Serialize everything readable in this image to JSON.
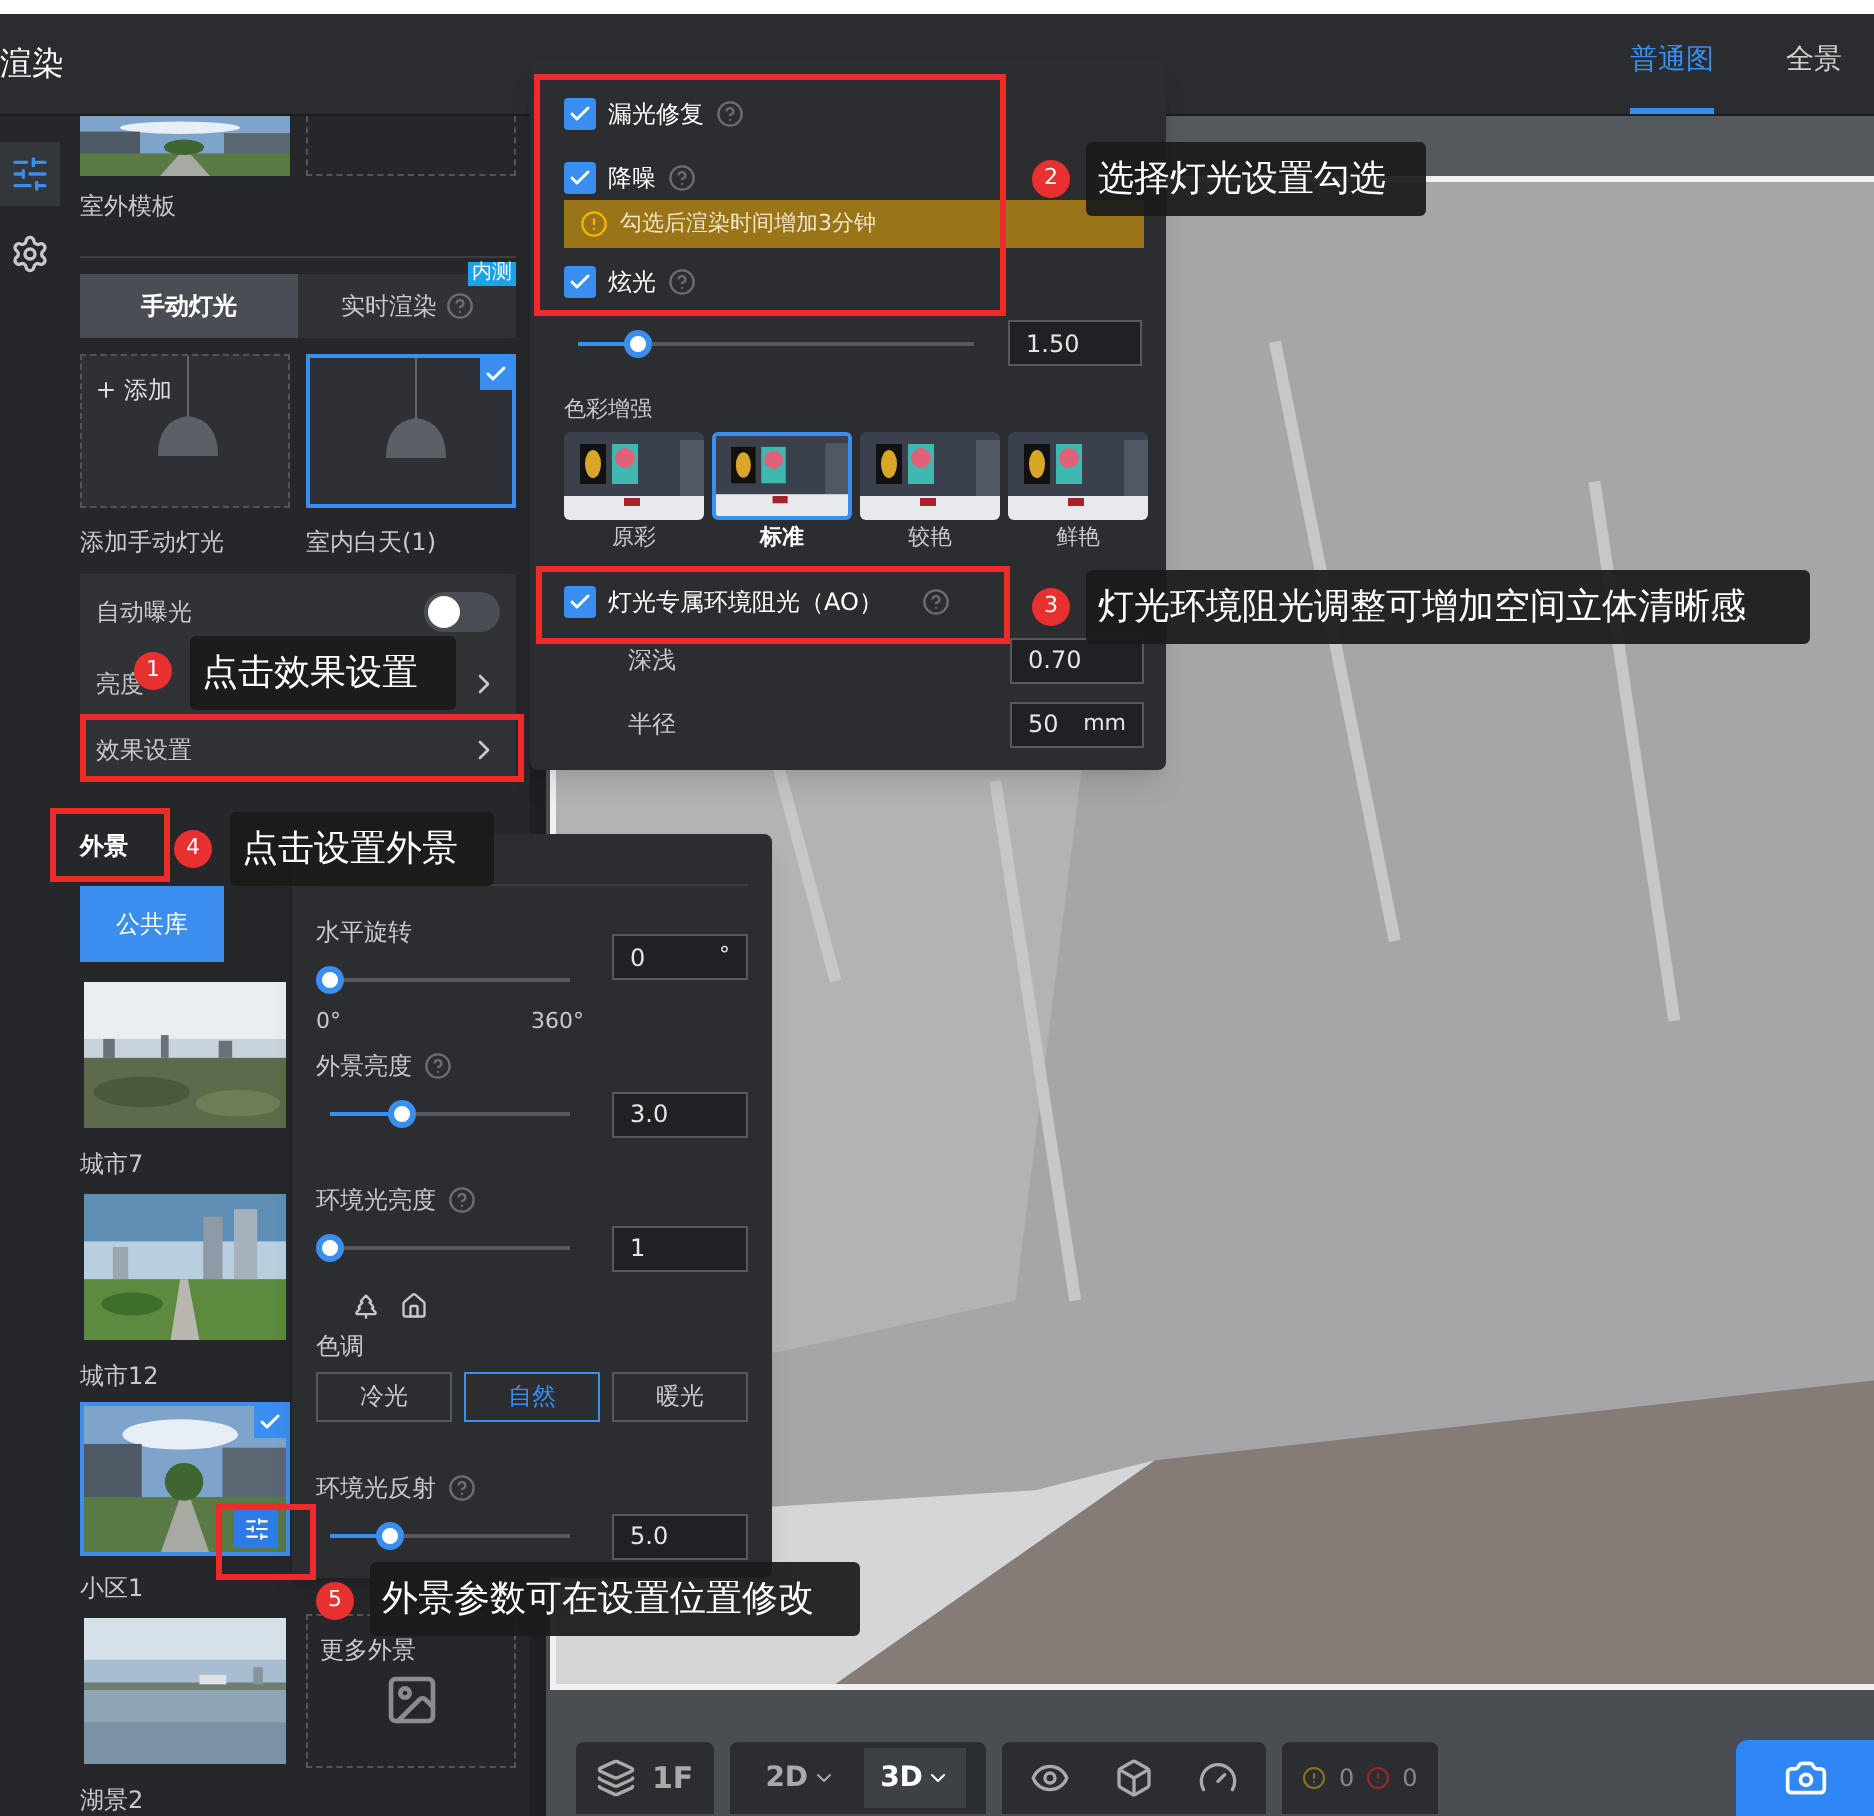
{
  "header": {
    "title": "渲染",
    "tabs": [
      {
        "label": "普通图",
        "selected": true
      },
      {
        "label": "全景",
        "selected": false
      }
    ]
  },
  "rail": [
    {
      "kind": "sliders",
      "selected": true
    },
    {
      "kind": "gear",
      "selected": false
    }
  ],
  "template": {
    "label": "室外模板"
  },
  "light_modes": [
    {
      "label": "手动灯光",
      "selected": true
    },
    {
      "label": "实时渲染",
      "selected": false,
      "help": true,
      "badge": "内测"
    }
  ],
  "light_presets": [
    {
      "kind": "add",
      "action": "添加",
      "label": "添加手动灯光",
      "selected": false
    },
    {
      "kind": "preset",
      "label": "室内白天(1)",
      "selected": true
    }
  ],
  "settings": {
    "auto_exposure": {
      "label": "自动曝光",
      "on": false
    },
    "links": [
      {
        "label": "亮度"
      },
      {
        "label": "效果设置"
      }
    ]
  },
  "outdoor": {
    "title": "外景",
    "tabs": [
      {
        "label": "公共库",
        "selected": true
      }
    ],
    "items": [
      {
        "label": "城市7",
        "selected": false
      },
      {
        "label": "城市12",
        "selected": false
      },
      {
        "label": "小区1",
        "selected": true
      },
      {
        "label": "湖景2",
        "selected": false
      }
    ],
    "more": {
      "label": "更多外景"
    }
  },
  "effects": {
    "options": [
      {
        "label": "漏光修复",
        "checked": true,
        "help": true
      },
      {
        "label": "降噪",
        "checked": true,
        "help": true,
        "warning": "勾选后渲染时间增加3分钟"
      },
      {
        "label": "炫光",
        "checked": true,
        "help": true
      }
    ],
    "glare": {
      "level": 0.15,
      "value": "1.50"
    },
    "color_enhance": {
      "title": "色彩增强",
      "options": [
        {
          "label": "原彩",
          "selected": false
        },
        {
          "label": "标准",
          "selected": true
        },
        {
          "label": "较艳",
          "selected": false
        },
        {
          "label": "鲜艳",
          "selected": false
        }
      ]
    },
    "ao": {
      "label": "灯光专属环境阻光（AO）",
      "checked": true,
      "help": true,
      "fields": [
        {
          "label": "深浅",
          "value": "0.70"
        },
        {
          "label": "半径",
          "value": "50",
          "unit": "mm"
        }
      ]
    }
  },
  "outdoor_settings": {
    "rotation": {
      "label": "水平旋转",
      "level": 0,
      "value": "0",
      "unit": "°",
      "min": "0°",
      "max": "360°"
    },
    "brightness": {
      "label": "外景亮度",
      "help": true,
      "level": 0.3,
      "value": "3.0"
    },
    "ambient": {
      "label": "环境光亮度",
      "help": true,
      "level": 0.0,
      "value": "1"
    },
    "tone": {
      "label": "色调",
      "options": [
        {
          "label": "冷光",
          "selected": false
        },
        {
          "label": "自然",
          "selected": true
        },
        {
          "label": "暖光",
          "selected": false
        }
      ]
    },
    "reflection": {
      "label": "环境光反射",
      "help": true,
      "level": 0.25,
      "value": "5.0"
    }
  },
  "toolbar": {
    "floor": "1F",
    "views": [
      {
        "label": "2D",
        "selected": false
      },
      {
        "label": "3D",
        "selected": true
      }
    ],
    "warnings": "0",
    "errors": "0"
  },
  "annotations": [
    {
      "number": "1",
      "text": "点击效果设置"
    },
    {
      "number": "2",
      "text": "选择灯光设置勾选"
    },
    {
      "number": "3",
      "text": "灯光环境阻光调整可增加空间立体清晰感"
    },
    {
      "number": "4",
      "text": "点击设置外景"
    },
    {
      "number": "5",
      "text": "外景参数可在设置位置修改"
    }
  ]
}
